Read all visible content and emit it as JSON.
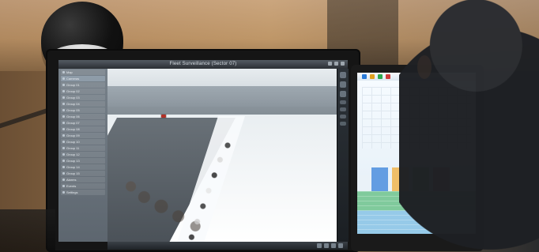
{
  "scene": {
    "main_monitor": {
      "window_title": "Fleet Surveillance (Sector 07)",
      "sidebar_items": [
        {
          "label": "Map"
        },
        {
          "label": "Cameras"
        },
        {
          "label": "Group 01"
        },
        {
          "label": "Group 02"
        },
        {
          "label": "Group 03"
        },
        {
          "label": "Group 04"
        },
        {
          "label": "Group 05"
        },
        {
          "label": "Group 06"
        },
        {
          "label": "Group 07"
        },
        {
          "label": "Group 08"
        },
        {
          "label": "Group 09"
        },
        {
          "label": "Group 10"
        },
        {
          "label": "Group 11"
        },
        {
          "label": "Group 12"
        },
        {
          "label": "Group 13"
        },
        {
          "label": "Group 14"
        },
        {
          "label": "Group 15"
        },
        {
          "label": "Alarms"
        },
        {
          "label": "Events"
        },
        {
          "label": "Settings"
        }
      ],
      "bottom_left_text": ""
    }
  }
}
